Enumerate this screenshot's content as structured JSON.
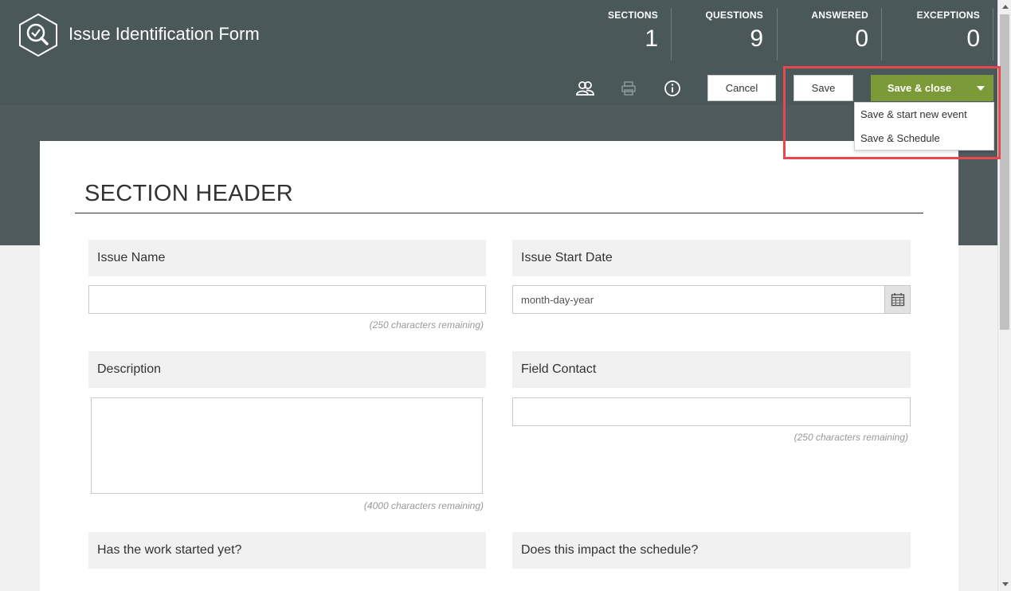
{
  "app": {
    "title": "Issue Identification Form",
    "logo_icon": "magnify-check-hexagon-icon"
  },
  "stats": [
    {
      "label": "SECTIONS",
      "value": "1"
    },
    {
      "label": "QUESTIONS",
      "value": "9"
    },
    {
      "label": "ANSWERED",
      "value": "0"
    },
    {
      "label": "EXCEPTIONS",
      "value": "0"
    }
  ],
  "toolbar": {
    "icons": [
      "users-icon",
      "print-icon",
      "info-icon"
    ],
    "cancel_label": "Cancel",
    "save_label": "Save",
    "save_close_label": "Save & close",
    "dropdown_items": [
      "Save & start new event",
      "Save & Schedule"
    ]
  },
  "section": {
    "title": "SECTION HEADER"
  },
  "questions": {
    "issue_name": {
      "label": "Issue Name",
      "value": "",
      "remaining": "(250 characters remaining)"
    },
    "issue_start_date": {
      "label": "Issue Start Date",
      "placeholder": "month-day-year"
    },
    "description": {
      "label": "Description",
      "value": "",
      "remaining": "(4000 characters remaining)"
    },
    "field_contact": {
      "label": "Field Contact",
      "value": "",
      "remaining": "(250 characters remaining)"
    },
    "work_started": {
      "label": "Has the work started yet?"
    },
    "impact_schedule": {
      "label": "Does this impact the schedule?"
    }
  },
  "colors": {
    "header_bg": "#4b5859",
    "accent_green": "#7b9b39",
    "highlight_red": "#e8484d"
  }
}
